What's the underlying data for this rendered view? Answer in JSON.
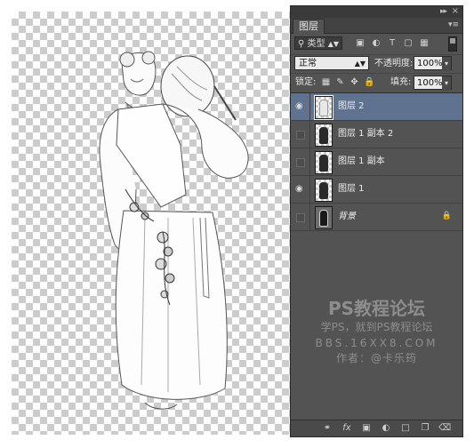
{
  "panel": {
    "tab_label": "图层",
    "filter_label": "类型",
    "blend_mode": "正常",
    "opacity_label": "不透明度:",
    "opacity_value": "100%",
    "lock_label": "锁定:",
    "fill_label": "填充:",
    "fill_value": "100%"
  },
  "layers": [
    {
      "name": "图层 2",
      "visible": true,
      "selected": true
    },
    {
      "name": "图层 1 副本 2",
      "visible": false,
      "selected": false
    },
    {
      "name": "图层 1 副本",
      "visible": false,
      "selected": false
    },
    {
      "name": "图层 1",
      "visible": true,
      "selected": false
    },
    {
      "name": "背景",
      "visible": false,
      "selected": false,
      "locked": true
    }
  ],
  "watermark": {
    "title": "PS教程论坛",
    "subtitle": "学PS，就到PS教程论坛",
    "site": "BBS.16XX8.COM",
    "author": "作者：@卡乐筠"
  },
  "icons": {
    "eye": "eye-icon",
    "lock": "lock-icon",
    "link": "link-icon",
    "fx": "fx-icon",
    "mask": "mask-icon",
    "adjustment": "adjustment-icon",
    "group": "folder-icon",
    "new_layer": "new-layer-icon",
    "delete": "trash-icon"
  }
}
